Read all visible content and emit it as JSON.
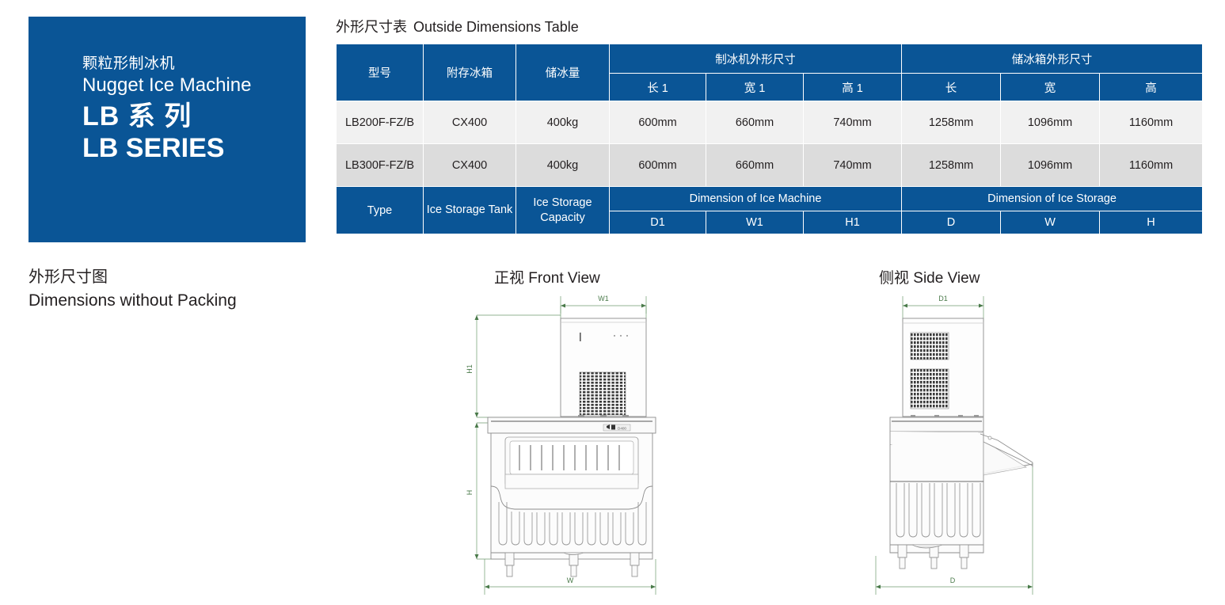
{
  "hero": {
    "product_cn": "颗粒形制冰机",
    "product_en": "Nugget Ice Machine",
    "series_cn": "LB 系    列",
    "series_en": "LB SERIES",
    "bg_color": "#0A5596"
  },
  "table_section": {
    "caption_cn": "外形尺寸表",
    "caption_en": "Outside Dimensions Table",
    "header_color": "#0A5596",
    "row_colors": [
      "#F1F1F1",
      "#DCDCDC"
    ],
    "group_headers_cn": {
      "model": "型号",
      "tank": "附存冰箱",
      "capacity": "储冰量",
      "machine_group": "制冰机外形尺寸",
      "storage_group": "储冰箱外形尺寸"
    },
    "sub_headers_cn": {
      "machine_length": "长 1",
      "machine_width": "宽 1",
      "machine_height": "高 1",
      "storage_length": "长",
      "storage_width": "宽",
      "storage_height": "高"
    },
    "rows": [
      {
        "model": "LB200F-FZ/B",
        "tank": "CX400",
        "capacity": "400kg",
        "machine_length": "600mm",
        "machine_width": "660mm",
        "machine_height": "740mm",
        "storage_length": "1258mm",
        "storage_width": "1096mm",
        "storage_height": "1160mm"
      },
      {
        "model": "LB300F-FZ/B",
        "tank": "CX400",
        "capacity": "400kg",
        "machine_length": "600mm",
        "machine_width": "660mm",
        "machine_height": "740mm",
        "storage_length": "1258mm",
        "storage_width": "1096mm",
        "storage_height": "1160mm"
      }
    ],
    "group_headers_en": {
      "model": "Type",
      "tank": "Ice Storage Tank",
      "capacity": "Ice Storage Capacity",
      "machine_group": "Dimension of Ice Machine",
      "storage_group": "Dimension of Ice Storage"
    },
    "sub_headers_en": {
      "machine_length": "D1",
      "machine_width": "W1",
      "machine_height": "H1",
      "storage_length": "D",
      "storage_width": "W",
      "storage_height": "H"
    }
  },
  "dimensions_section": {
    "caption_cn": "外形尺寸图",
    "caption_en": "Dimensions without Packing",
    "front_view_title": "正视 Front View",
    "side_view_title": "侧视 Side View",
    "front_view_dims": {
      "top_width": "W1",
      "top_height": "H1",
      "base_height": "H",
      "base_width": "W"
    },
    "side_view_dims": {
      "top_depth": "D1",
      "base_depth": "D"
    },
    "panel_badge": "D400",
    "dim_line_color": "#4a7a4a"
  }
}
